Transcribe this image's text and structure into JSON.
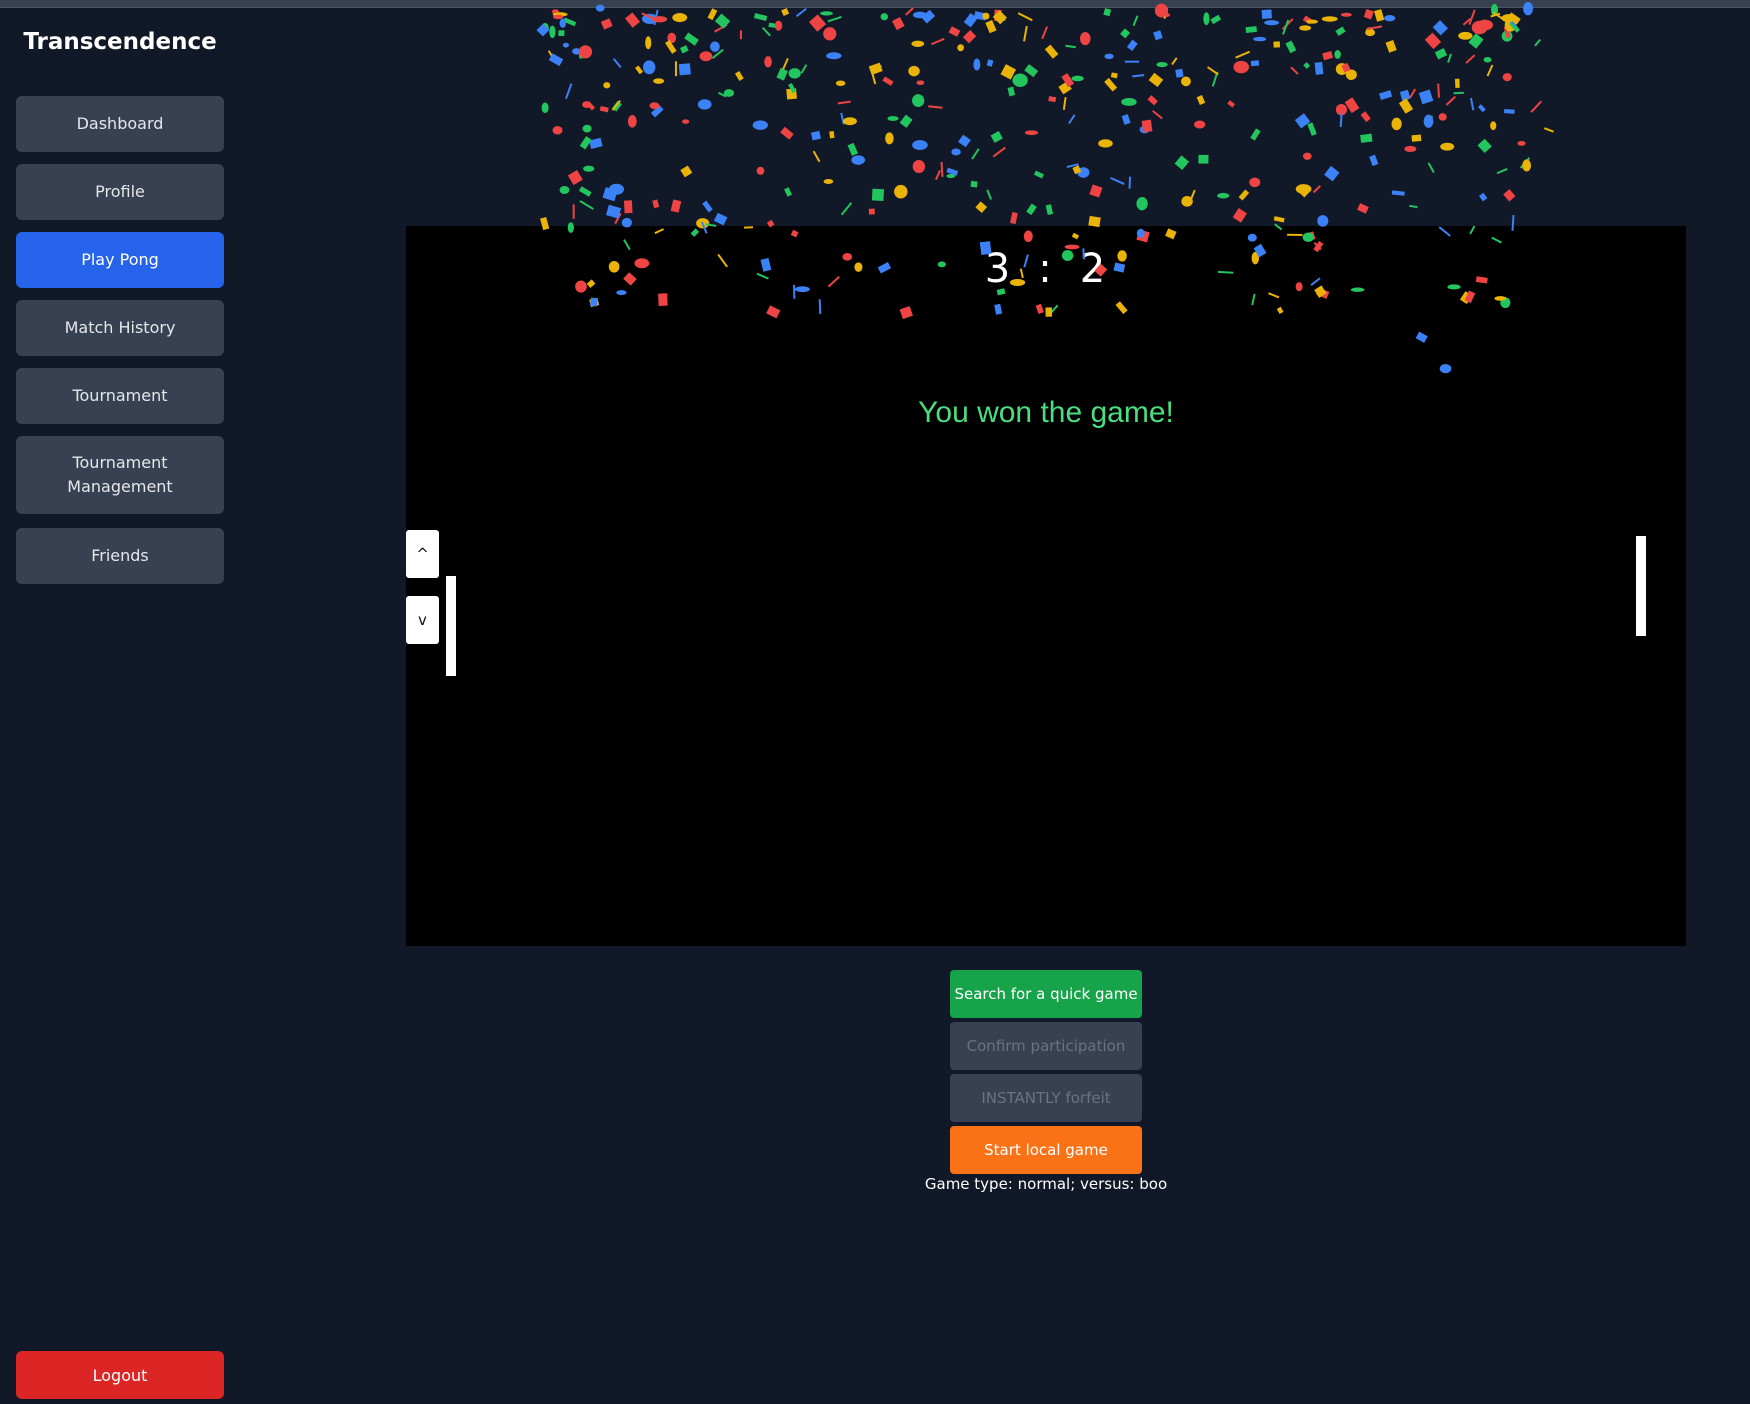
{
  "app": {
    "title": "Transcendence"
  },
  "sidebar": {
    "items": [
      {
        "label": "Dashboard"
      },
      {
        "label": "Profile"
      },
      {
        "label": "Play Pong",
        "active": true
      },
      {
        "label": "Match History"
      },
      {
        "label": "Tournament"
      },
      {
        "label": "Tournament Management"
      },
      {
        "label": "Friends"
      }
    ],
    "logout_label": "Logout"
  },
  "game": {
    "score_left": "3",
    "score_separator": ":",
    "score_right": "2",
    "result_message": "You won the game!",
    "up_control_label": "^",
    "down_control_label": "v"
  },
  "actions": {
    "quick_game": "Search for a quick game",
    "confirm": "Confirm participation",
    "forfeit": "INSTANTLY forfeit",
    "local_game": "Start local game"
  },
  "status": {
    "game_type_line": "Game type: normal; versus: boo"
  },
  "colors": {
    "page_bg": "#111827",
    "nav_bg": "#374151",
    "active_nav": "#2563eb",
    "logout": "#dc2626",
    "quick_game": "#16a34a",
    "local_game": "#f97316",
    "disabled_bg": "#374151",
    "disabled_text": "#6b7280",
    "win_text": "#4ade80",
    "confetti": [
      "#3b82f6",
      "#22c55e",
      "#eab308",
      "#ef4444"
    ]
  }
}
